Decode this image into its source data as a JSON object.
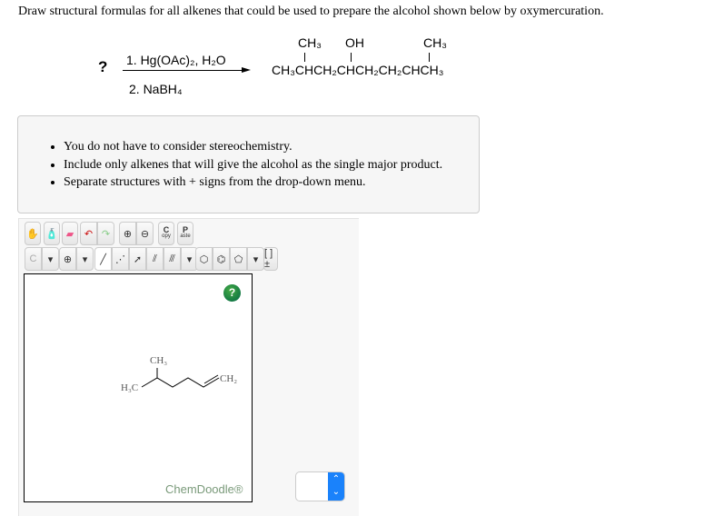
{
  "question": "Draw structural formulas for all alkenes that could be used to prepare the alcohol shown below by oxymercuration.",
  "reaction": {
    "unknown": "?",
    "step1": "1. Hg(OAc)₂, H₂O",
    "step2": "2. NaBH₄",
    "product": {
      "sub1": "CH₃",
      "sub2": "OH",
      "sub3": "CH₃",
      "chain": "CH₃CHCH₂CHCH₂CH₂CHCH₃"
    }
  },
  "instructions": [
    "You do not have to consider stereochemistry.",
    "Include only alkenes that will give the alcohol as the single major product.",
    "Separate structures with + signs from the drop-down menu."
  ],
  "toolbar": {
    "copy": "C",
    "copy_sub": "opy",
    "paste": "P",
    "paste_sub": "aste",
    "element": "C",
    "charge": "⊕",
    "brackets": "[ ]±"
  },
  "canvas": {
    "help": "?",
    "label_ch3": "CH₃",
    "label_h3c": "H₃C",
    "label_ch2": "CH₂",
    "brand": "ChemDoodle®"
  },
  "separator_select": {
    "value": ""
  }
}
